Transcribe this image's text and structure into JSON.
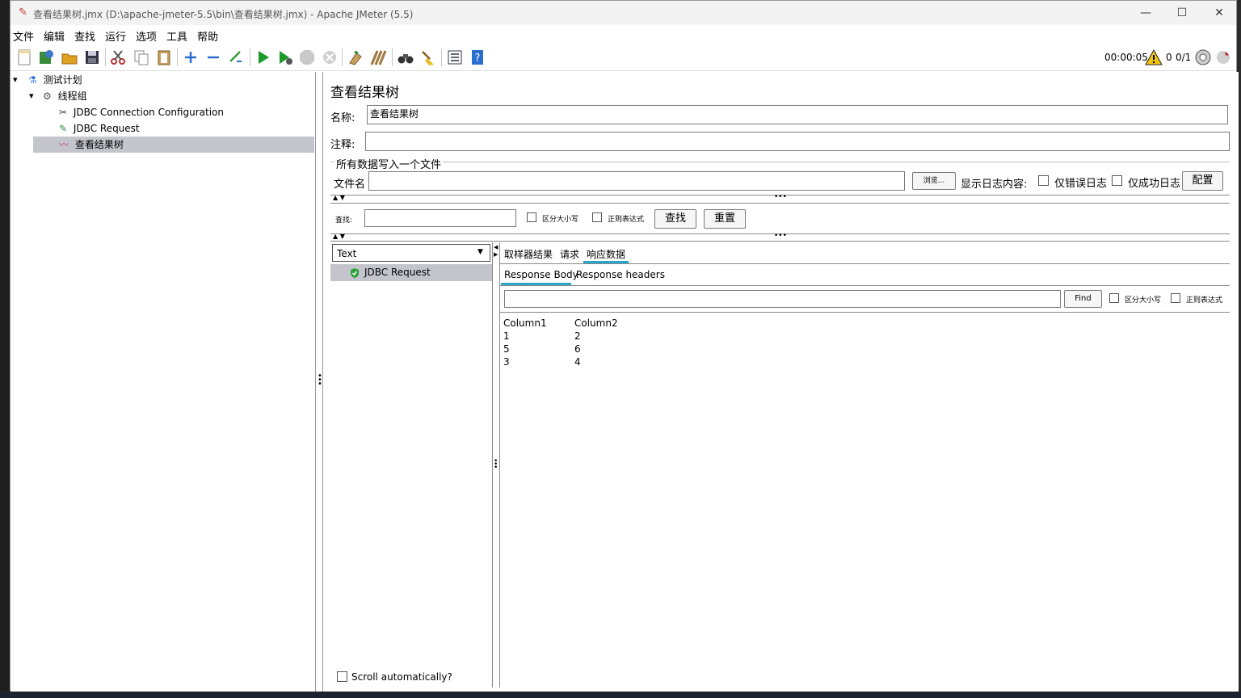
{
  "window": {
    "title": "查看结果树.jmx (D:\\apache-jmeter-5.5\\bin\\查看结果树.jmx) - Apache JMeter (5.5)",
    "controls": [
      "—",
      "☐",
      "✕"
    ]
  },
  "menu": [
    "文件",
    "编辑",
    "查找",
    "运行",
    "选项",
    "工具",
    "帮助"
  ],
  "toolbar": {
    "elapsed": "00:00:05",
    "warnings": "0",
    "threads": "0/1"
  },
  "tree": {
    "test_plan": "测试计划",
    "thread_group": "线程组",
    "jdbc_config": "JDBC Connection Configuration",
    "jdbc_request": "JDBC Request",
    "view_results_tree": "查看结果树"
  },
  "panel": {
    "heading": "查看结果树",
    "name_label": "名称:",
    "name_value": "查看结果树",
    "comment_label": "注释:",
    "comment_value": "",
    "file_group_title": "所有数据写入一个文件",
    "filename_label": "文件名",
    "filename_value": "",
    "browse_button": "浏览...",
    "log_content_label": "显示日志内容:",
    "errors_only": "仅错误日志",
    "success_only": "仅成功日志",
    "configure_button": "配置",
    "search_label": "查找:",
    "search_value": "",
    "case_sensitive": "区分大小写",
    "regex": "正则表达式",
    "search_button": "查找",
    "reset_button": "重置"
  },
  "results": {
    "renderer": "Text",
    "samples": [
      "JDBC Request"
    ],
    "scroll_auto": "Scroll automatically?",
    "tabs": [
      "取样器结果",
      "请求",
      "响应数据"
    ],
    "active_tab": "响应数据",
    "sub_tabs": [
      "Response Body",
      "Response headers"
    ],
    "find_value": "",
    "find_button": "Find",
    "find_case": "区分大小写",
    "find_regex": "正则表达式",
    "table_header": [
      "Column1",
      "Column2"
    ],
    "table_rows": [
      [
        "1",
        "2"
      ],
      [
        "5",
        "6"
      ],
      [
        "3",
        "4"
      ]
    ]
  }
}
